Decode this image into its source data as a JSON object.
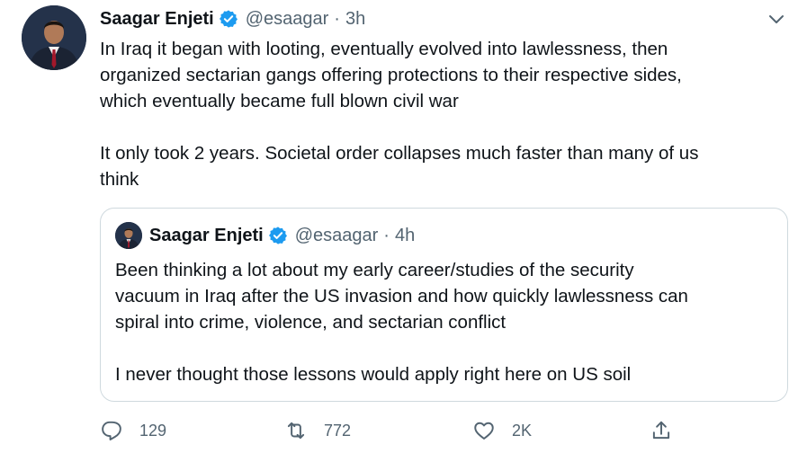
{
  "tweet": {
    "author_name": "Saagar Enjeti",
    "handle": "@esaagar",
    "separator": "·",
    "time": "3h",
    "text": "In Iraq it began with looting, eventually evolved into lawlessness, then\norganized sectarian gangs offering protections to their respective sides,\nwhich eventually became full blown civil war\n\nIt only took 2 years. Societal order collapses much faster than many of us\nthink"
  },
  "quoted": {
    "author_name": "Saagar Enjeti",
    "handle": "@esaagar",
    "separator": "·",
    "time": "4h",
    "text": "Been thinking a lot about my early career/studies of the security\nvacuum in Iraq after the US invasion and how quickly lawlessness can\nspiral into crime, violence, and sectarian conflict\n\nI never thought those lessons would apply right here on US soil"
  },
  "actions": {
    "replies": "129",
    "retweets": "772",
    "likes": "2K"
  },
  "icons": {
    "verified": "verified-badge-icon",
    "caret": "chevron-down-icon",
    "reply": "reply-icon",
    "retweet": "retweet-icon",
    "like": "heart-icon",
    "share": "share-icon"
  },
  "colors": {
    "verified": "#1d9bf0",
    "muted": "#536471",
    "border": "#cfd9de"
  }
}
